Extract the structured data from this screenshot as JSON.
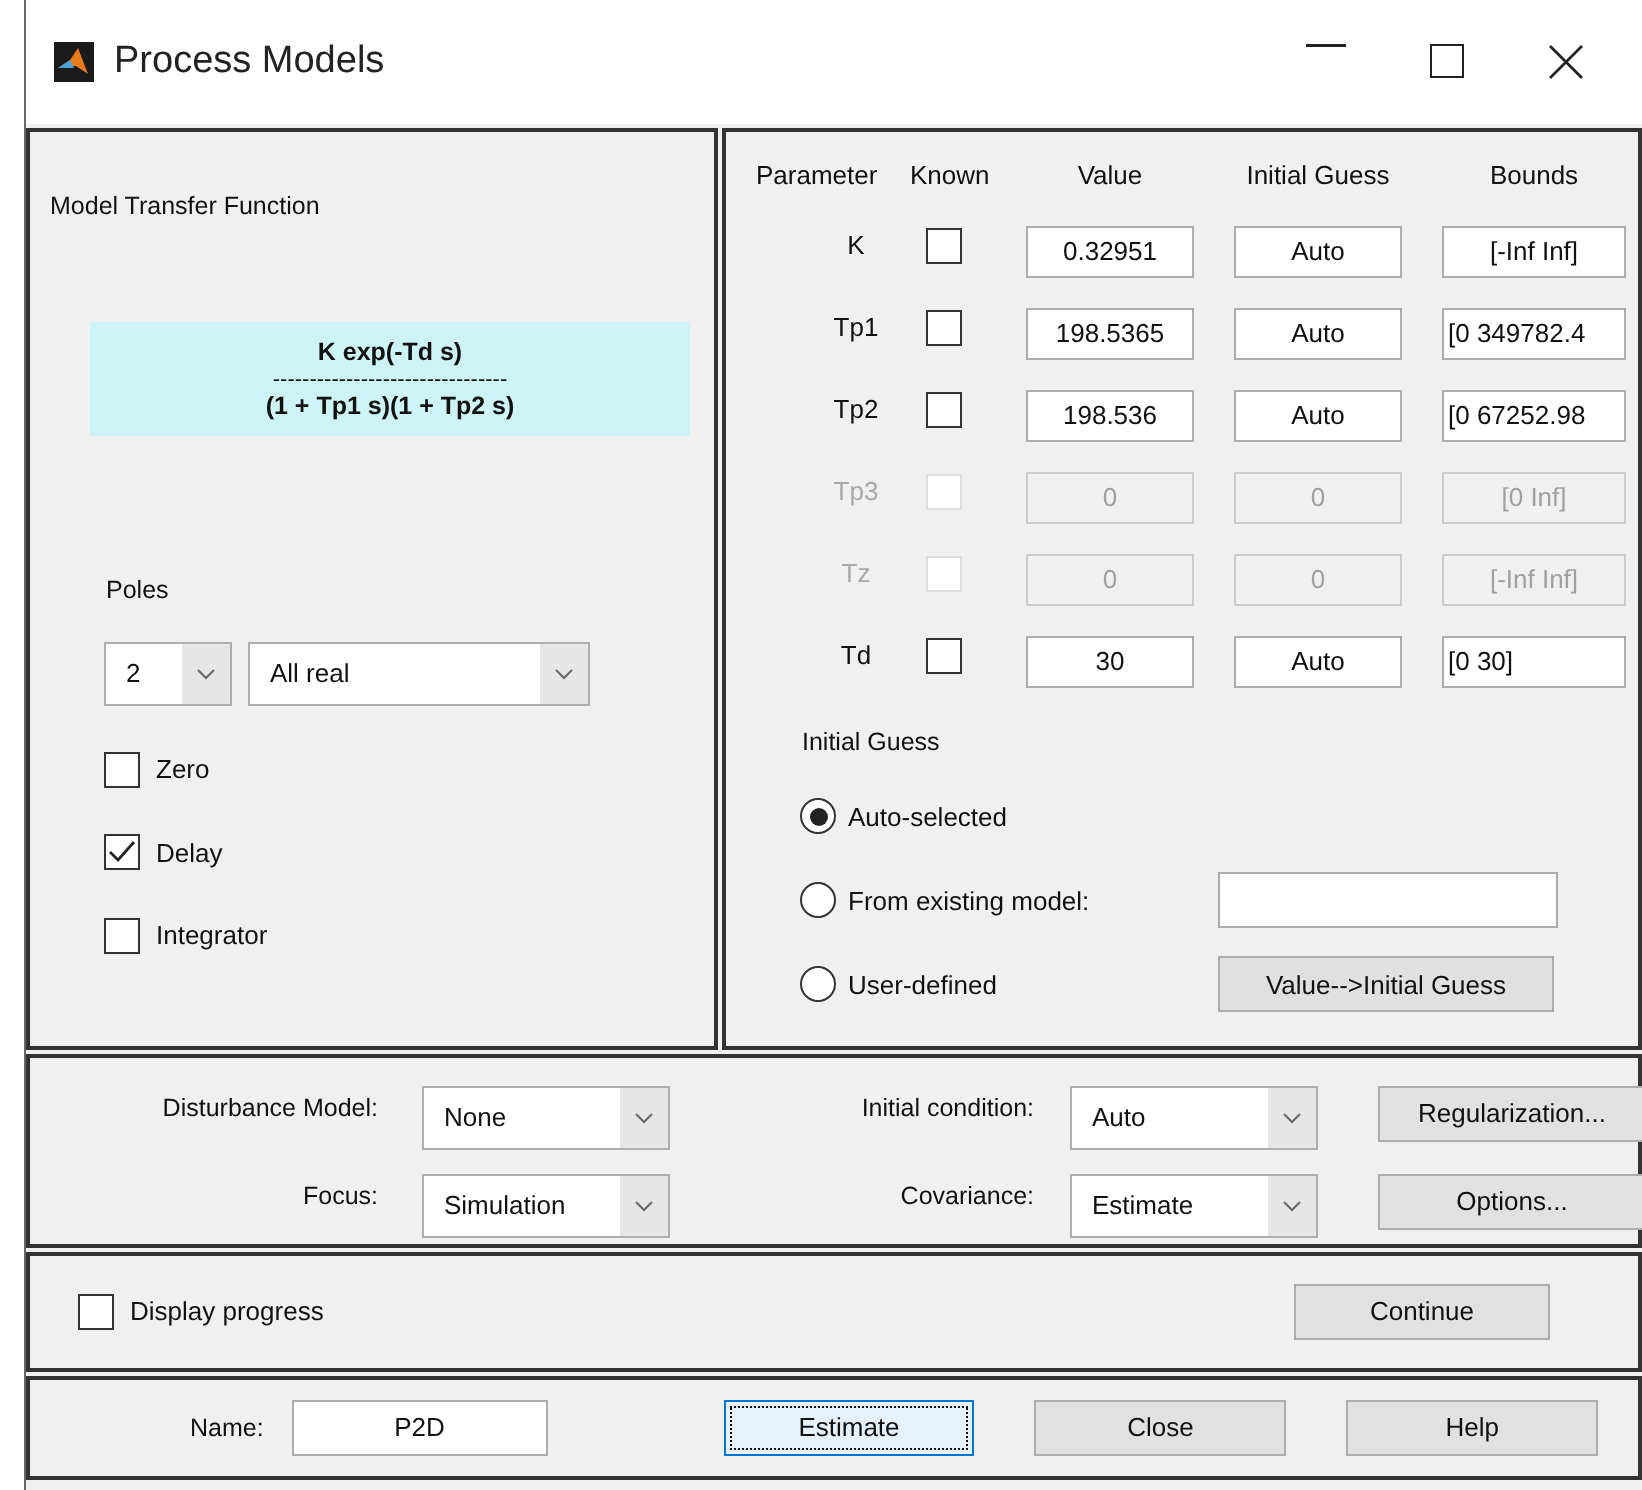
{
  "window": {
    "title": "Process Models"
  },
  "transfer_function": {
    "label": "Model Transfer Function",
    "numerator": "K exp(-Td s)",
    "fraction_line": "--------------------------------",
    "denominator": "(1 + Tp1 s)(1 + Tp2 s)"
  },
  "poles": {
    "label": "Poles",
    "count": "2",
    "type": "All real"
  },
  "options": [
    {
      "label": "Zero",
      "checked": false
    },
    {
      "label": "Delay",
      "checked": true
    },
    {
      "label": "Integrator",
      "checked": false
    }
  ],
  "parameters": {
    "columns": [
      "Parameter",
      "Known",
      "Value",
      "Initial Guess",
      "Bounds"
    ],
    "rows": [
      {
        "name": "K",
        "known": false,
        "value": "0.32951",
        "initial_guess": "Auto",
        "bounds": "[-Inf Inf]",
        "disabled": false
      },
      {
        "name": "Tp1",
        "known": false,
        "value": "198.5365",
        "initial_guess": "Auto",
        "bounds": "[0 349782.4",
        "disabled": false
      },
      {
        "name": "Tp2",
        "known": false,
        "value": "198.536",
        "initial_guess": "Auto",
        "bounds": "[0 67252.98",
        "disabled": false
      },
      {
        "name": "Tp3",
        "known": false,
        "value": "0",
        "initial_guess": "0",
        "bounds": "[0 Inf]",
        "disabled": true
      },
      {
        "name": "Tz",
        "known": false,
        "value": "0",
        "initial_guess": "0",
        "bounds": "[-Inf Inf]",
        "disabled": true
      },
      {
        "name": "Td",
        "known": false,
        "value": "30",
        "initial_guess": "Auto",
        "bounds": "[0 30]",
        "disabled": false
      }
    ]
  },
  "initial_guess": {
    "label": "Initial Guess",
    "choices": [
      {
        "label": "Auto-selected",
        "selected": true
      },
      {
        "label": "From existing model:",
        "selected": false
      },
      {
        "label": "User-defined",
        "selected": false
      }
    ],
    "button": "Value-->Initial Guess"
  },
  "estimation": {
    "fields": [
      {
        "label": "Disturbance Model:",
        "value": "None"
      },
      {
        "label": "Initial condition:",
        "value": "Auto"
      },
      {
        "label": "Focus:",
        "value": "Simulation"
      },
      {
        "label": "Covariance:",
        "value": "Estimate"
      }
    ],
    "buttons": [
      "Regularization...",
      "Options..."
    ]
  },
  "progress": {
    "label": "Display progress",
    "checked": false,
    "button": "Continue"
  },
  "footer": {
    "name_label": "Name:",
    "name_value": "P2D",
    "buttons": [
      {
        "label": "Estimate",
        "focused": true
      },
      {
        "label": "Close",
        "focused": false
      },
      {
        "label": "Help",
        "focused": false
      }
    ]
  }
}
